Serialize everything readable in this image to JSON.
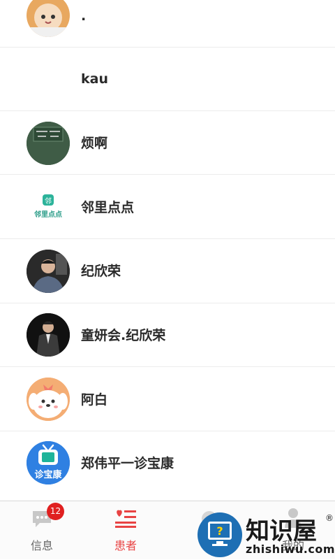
{
  "contacts": [
    {
      "name": ".",
      "avatar_icon": "cat-lion-costume-avatar"
    },
    {
      "name": "kau",
      "avatar_icon": "none"
    },
    {
      "name": "烦啊",
      "avatar_icon": "chalkboard-avatar"
    },
    {
      "name": "邻里点点",
      "avatar_icon": "linli-diandian-logo",
      "avatar_text": "邻里点点"
    },
    {
      "name": "纪欣荣",
      "avatar_icon": "man-photo-avatar"
    },
    {
      "name": "童妍会.纪欣荣",
      "avatar_icon": "man-suit-photo-avatar"
    },
    {
      "name": "阿白",
      "avatar_icon": "cartoon-puppy-avatar"
    },
    {
      "name": "郑伟平一诊宝康",
      "avatar_icon": "zhenbaokang-tv-logo",
      "avatar_text": "诊宝康"
    }
  ],
  "tabs": [
    {
      "label": "信息",
      "icon": "chat-bubble-icon",
      "badge": "12",
      "active": false
    },
    {
      "label": "患者",
      "icon": "heart-list-icon",
      "active": true
    },
    {
      "label": "",
      "icon": "hidden-tab-icon",
      "active": false
    },
    {
      "label": "我的",
      "icon": "person-icon",
      "active": false
    }
  ],
  "watermark": {
    "title": "知识屋",
    "url": "zhishiwu.com",
    "icon": "question-mark-monitor-icon"
  },
  "colors": {
    "accent": "#e84343",
    "badge": "#e02020",
    "watermark_blue": "#1e6fb4"
  }
}
